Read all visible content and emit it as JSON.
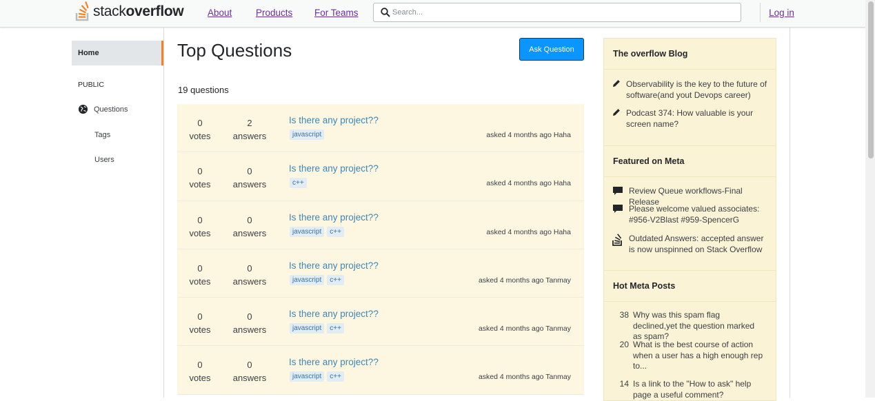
{
  "header": {
    "logo_text_light": "stack",
    "logo_text_bold": "overflow",
    "nav": [
      "About",
      "Products",
      "For Teams"
    ],
    "search_placeholder": "Search...",
    "login": "Log in"
  },
  "sidebar": {
    "home": "Home",
    "public": "PUBLIC",
    "questions": "Questions",
    "tags": "Tags",
    "users": "Users"
  },
  "main": {
    "title": "Top Questions",
    "ask_button": "Ask Question",
    "count": "19 questions",
    "questions": [
      {
        "votes": "0",
        "votes_label": "votes",
        "answers": "2",
        "answers_label": "answers",
        "title": "Is there any project??",
        "tags": [
          "javascript"
        ],
        "asked": "asked 4 months ago Haha"
      },
      {
        "votes": "0",
        "votes_label": "votes",
        "answers": "0",
        "answers_label": "answers",
        "title": "Is there any project??",
        "tags": [
          "c++"
        ],
        "asked": "asked 4 months ago Haha"
      },
      {
        "votes": "0",
        "votes_label": "votes",
        "answers": "0",
        "answers_label": "answers",
        "title": "Is there any project??",
        "tags": [
          "javascript",
          "c++"
        ],
        "asked": "asked 4 months ago Haha"
      },
      {
        "votes": "0",
        "votes_label": "votes",
        "answers": "0",
        "answers_label": "answers",
        "title": "Is there any project??",
        "tags": [
          "javascript",
          "c++"
        ],
        "asked": "asked 4 months ago Tanmay"
      },
      {
        "votes": "0",
        "votes_label": "votes",
        "answers": "0",
        "answers_label": "answers",
        "title": "Is there any project??",
        "tags": [
          "javascript",
          "c++"
        ],
        "asked": "asked 4 months ago Tanmay"
      },
      {
        "votes": "0",
        "votes_label": "votes",
        "answers": "0",
        "answers_label": "answers",
        "title": "Is there any project??",
        "tags": [
          "javascript",
          "c++"
        ],
        "asked": "asked 4 months ago Tanmay"
      }
    ]
  },
  "right": {
    "blog": {
      "title": "The overflow Blog",
      "items": [
        {
          "icon": "pencil-icon",
          "text": "Observability is the key to the future of software(and yout Devops career)"
        },
        {
          "icon": "pencil-icon",
          "text": "Podcast 374: How valuable is your screen name?"
        }
      ]
    },
    "meta": {
      "title": "Featured on Meta",
      "items": [
        {
          "icon": "comment-icon",
          "text": "Review Queue workflows-Final Release"
        },
        {
          "icon": "comment-icon",
          "text": "Please welcome valued associates: #956-V2Blast #959-SpencerG"
        },
        {
          "icon": "stackoverflow-icon",
          "text": "Outdated Answers: accepted answer is now unspinned on Stack Overflow"
        }
      ]
    },
    "hot": {
      "title": "Hot Meta Posts",
      "items": [
        {
          "num": "38",
          "text": "Why was this spam flag declined,yet the question marked as spam?"
        },
        {
          "num": "20",
          "text": "What is the best course of action when a user has a high enough rep to..."
        },
        {
          "num": "14",
          "text": "Is a link to the \"How to ask\" help page a useful comment?"
        }
      ]
    }
  },
  "colors": {
    "accent": "#f48225",
    "link": "#3c86b8",
    "button": "#0a95ff",
    "row_bg": "#fdf7e2",
    "widget_bg": "#fbf3d5"
  }
}
